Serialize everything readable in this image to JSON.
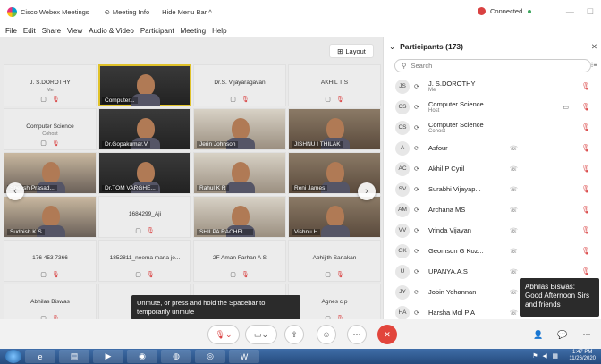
{
  "titlebar": {
    "app": "Cisco Webex Meetings",
    "meeting_info": "Meeting Info",
    "hide_menu": "Hide Menu Bar ^",
    "status": "Connected"
  },
  "menu": [
    "File",
    "Edit",
    "Share",
    "View",
    "Audio & Video",
    "Participant",
    "Meeting",
    "Help"
  ],
  "layout_label": "Layout",
  "tiles": [
    {
      "name": "J. S.DOROTHY",
      "sub": "Me",
      "kind": "blank"
    },
    {
      "name": "Computer...",
      "sub": "(Host)",
      "kind": "video"
    },
    {
      "name": "Dr.S. Vijayaragavan",
      "sub": "",
      "kind": "blank"
    },
    {
      "name": "AKHIL T S",
      "sub": "",
      "kind": "blank"
    },
    {
      "name": "Computer Science",
      "sub": "Cohost",
      "kind": "blank"
    },
    {
      "name": "Dr.Gopakumar.V",
      "sub": "",
      "kind": "video"
    },
    {
      "name": "Jerin Johnson",
      "sub": "",
      "kind": "video"
    },
    {
      "name": "JISHNU I THILAK",
      "sub": "",
      "kind": "video"
    },
    {
      "name": "Sheesh Prasad...",
      "sub": "",
      "kind": "video"
    },
    {
      "name": "Dr.TOM VARGHE...",
      "sub": "",
      "kind": "video"
    },
    {
      "name": "Rahul K R",
      "sub": "",
      "kind": "video"
    },
    {
      "name": "Reni James",
      "sub": "",
      "kind": "video"
    },
    {
      "name": "Sudhish K S",
      "sub": "",
      "kind": "video"
    },
    {
      "name": "1684299_Aji",
      "sub": "",
      "kind": "blank"
    },
    {
      "name": "SHILPA RACHEL ...",
      "sub": "",
      "kind": "video"
    },
    {
      "name": "Vishnu H",
      "sub": "",
      "kind": "video"
    },
    {
      "name": "176 453 7366",
      "sub": "",
      "kind": "blank"
    },
    {
      "name": "1852811_neema maria jo...",
      "sub": "",
      "kind": "blank"
    },
    {
      "name": "2F Aman Farhan A S",
      "sub": "",
      "kind": "blank"
    },
    {
      "name": "Abhijith Sanakan",
      "sub": "",
      "kind": "blank"
    },
    {
      "name": "Abhilas Biswas",
      "sub": "",
      "kind": "blank"
    },
    {
      "name": "adarsh",
      "sub": "",
      "kind": "blank"
    },
    {
      "name": "",
      "sub": "",
      "kind": "blank"
    },
    {
      "name": "Agnes c p",
      "sub": "",
      "kind": "blank"
    }
  ],
  "tooltip": "Unmute, or press and hold the Spacebar to temporarily unmute",
  "participants": {
    "header": "Participants (173)",
    "search_placeholder": "Search",
    "list": [
      {
        "initials": "JS",
        "name": "J. S.DOROTHY",
        "role": "Me"
      },
      {
        "initials": "CS",
        "name": "Computer Science",
        "role": "Host"
      },
      {
        "initials": "CS",
        "name": "Computer Science",
        "role": "Cohost"
      },
      {
        "initials": "A",
        "name": "Asfour",
        "role": ""
      },
      {
        "initials": "AC",
        "name": "Akhil P Cyril",
        "role": ""
      },
      {
        "initials": "SV",
        "name": "Surabhi Vijayap...",
        "role": ""
      },
      {
        "initials": "AM",
        "name": "Archana MS",
        "role": ""
      },
      {
        "initials": "VV",
        "name": "Vrinda Vijayan",
        "role": ""
      },
      {
        "initials": "GK",
        "name": "Geomson G Koz...",
        "role": ""
      },
      {
        "initials": "U",
        "name": "UPANYA.A.S",
        "role": ""
      },
      {
        "initials": "JY",
        "name": "Jobin Yohannan",
        "role": ""
      },
      {
        "initials": "HA",
        "name": "Harsha Mol P A",
        "role": ""
      }
    ]
  },
  "chat_popup": "Abhilas Biswas: Good Afternoon Sirs and friends",
  "clock": {
    "time": "1:47 PM",
    "date": "11/26/2020"
  }
}
